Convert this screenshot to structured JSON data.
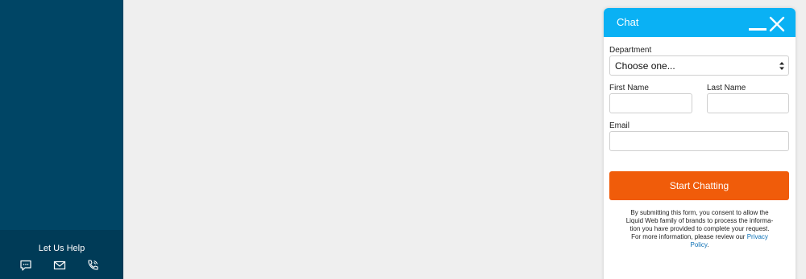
{
  "sidebar": {
    "help_title": "Let Us Help",
    "icons": [
      "chat-bubble-icon",
      "envelope-icon",
      "phone-icon"
    ]
  },
  "chat": {
    "title": "Chat",
    "department_label": "Department",
    "department_value": "Choose one...",
    "first_name_label": "First Name",
    "last_name_label": "Last Name",
    "email_label": "Email",
    "first_name_value": "",
    "last_name_value": "",
    "email_value": "",
    "start_button": "Start Chatting",
    "disclaimer_line1": "By submitting this form, you consent to allow the",
    "disclaimer_line2": "Liquid Web family of brands to process the informa-",
    "disclaimer_line3": "tion you have provided to complete your request.",
    "disclaimer_line4": "For more information, please review our",
    "privacy_link_part1": "Privacy",
    "privacy_link_part2": "Policy",
    "privacy_period": "."
  },
  "colors": {
    "sidebar": "#004565",
    "sidebar_help": "#003b57",
    "header": "#0ab1f4",
    "button": "#f05c0a",
    "link": "#0a6fb5",
    "background": "#efefef"
  }
}
